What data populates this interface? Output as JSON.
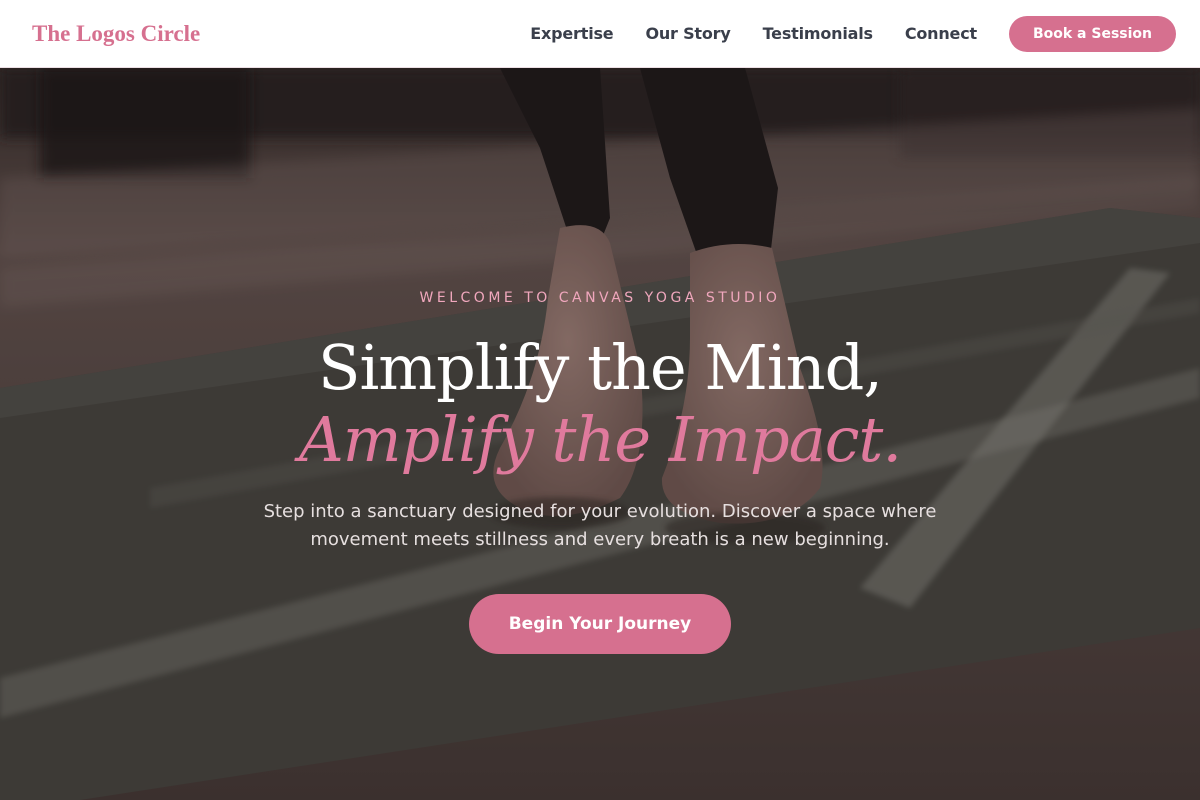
{
  "header": {
    "brand": "The Logos Circle",
    "nav": [
      {
        "label": "Expertise"
      },
      {
        "label": "Our Story"
      },
      {
        "label": "Testimonials"
      },
      {
        "label": "Connect"
      }
    ],
    "book_label": "Book a Session"
  },
  "hero": {
    "background": "yoga-mat-feet-photo",
    "eyebrow": "WELCOME TO CANVAS YOGA STUDIO",
    "headline_line1": "Simplify the Mind,",
    "headline_line2": "Amplify the Impact.",
    "subtext": "Step into a sanctuary designed for your evolution. Discover a space where movement meets stillness and every breath is a new beginning.",
    "cta_label": "Begin Your Journey"
  },
  "colors": {
    "accent": "#d6708f",
    "nav_text": "#3a3f4b",
    "eyebrow": "#f0a7bd",
    "headline": "#ffffff"
  }
}
